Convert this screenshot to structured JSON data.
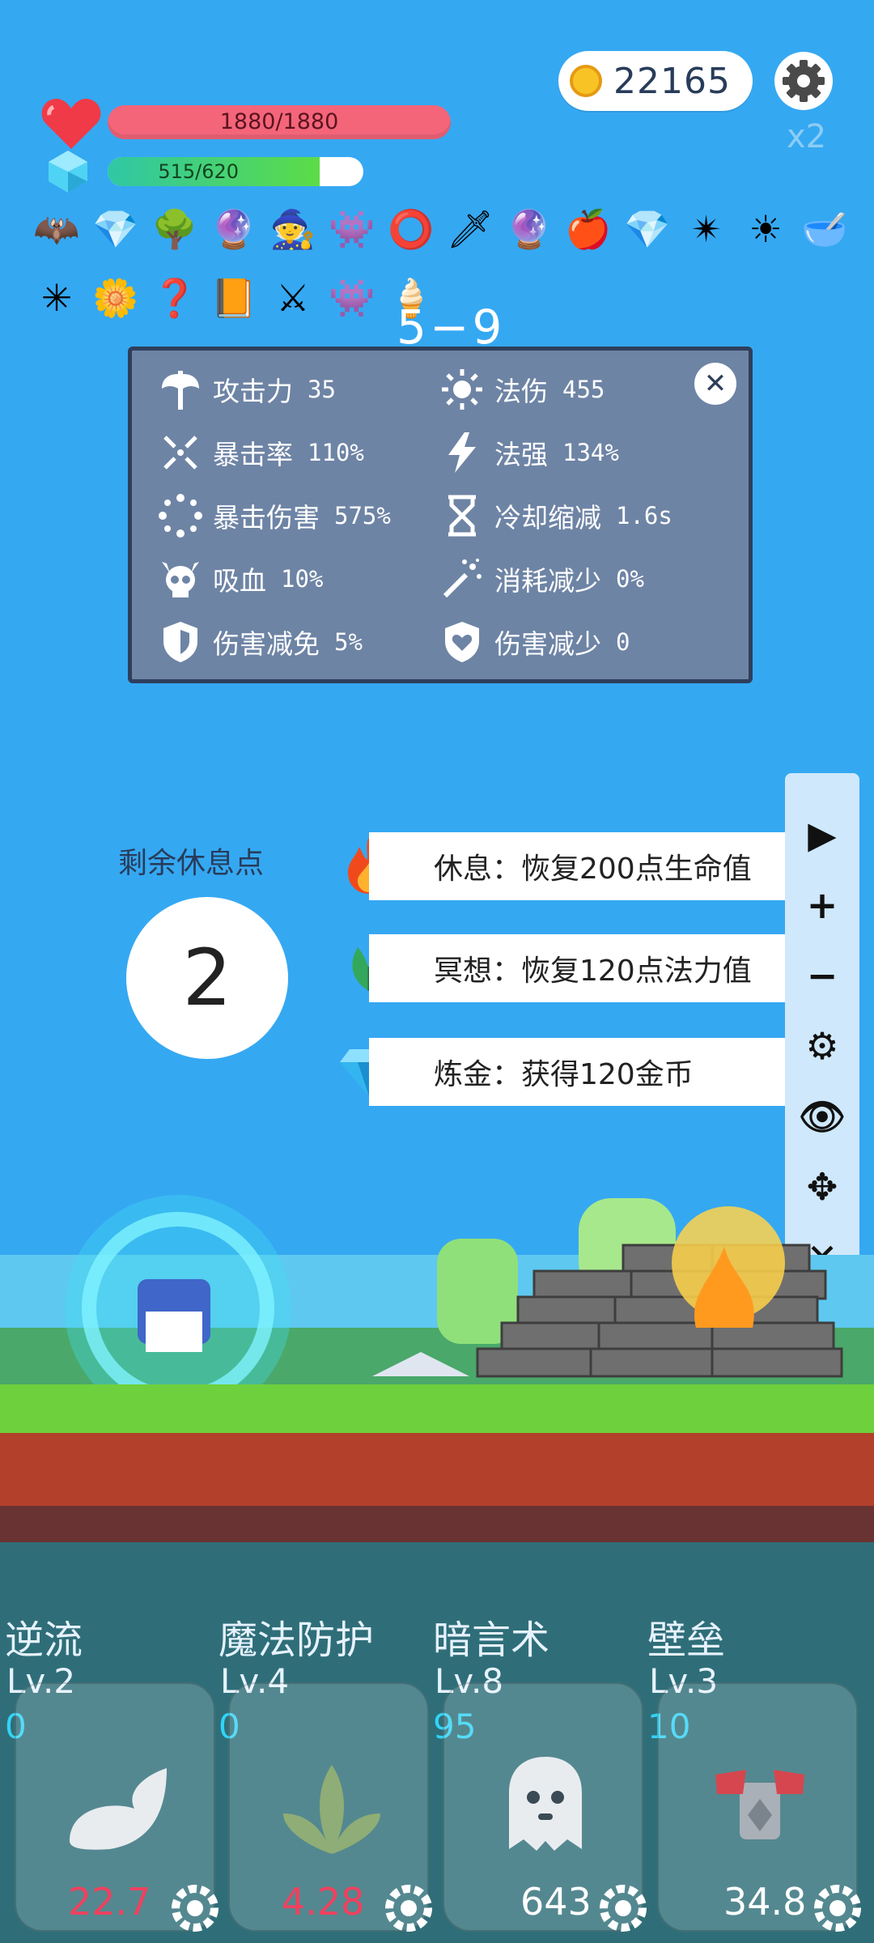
{
  "hud": {
    "coins": "22165",
    "speed": "x2",
    "hp_text": "1880/1880",
    "hp_fraction": 1.0,
    "mp_text": "515/620",
    "mp_fraction": 0.83
  },
  "stage": "5−9",
  "items_row1": [
    "bat",
    "diamond",
    "tree",
    "crystal-ball",
    "wizard-hat",
    "green-slime",
    "shield-ring",
    "dagger",
    "crystal-ball",
    "apple",
    "diamond",
    "spiked-ball",
    "sun",
    "mortar"
  ],
  "items_row2": [
    "spiked-mace",
    "flower",
    "hook",
    "book",
    "sword",
    "green-slime",
    "ice-cream"
  ],
  "stats": {
    "items": [
      {
        "label": "攻击力",
        "value": "35",
        "icon": "axe-icon"
      },
      {
        "label": "法伤",
        "value": "455",
        "icon": "sun-icon"
      },
      {
        "label": "暴击率",
        "value": "110%",
        "icon": "crit-icon"
      },
      {
        "label": "法强",
        "value": "134%",
        "icon": "lightning-icon"
      },
      {
        "label": "暴击伤害",
        "value": "575%",
        "icon": "circle-dots-icon"
      },
      {
        "label": "冷却缩减",
        "value": "1.6s",
        "icon": "hourglass-icon"
      },
      {
        "label": "吸血",
        "value": "10%",
        "icon": "skull-icon"
      },
      {
        "label": "消耗减少",
        "value": "0%",
        "icon": "wand-icon"
      },
      {
        "label": "伤害减免",
        "value": "5%",
        "icon": "shield-icon"
      },
      {
        "label": "伤害减少",
        "value": "0",
        "icon": "heart-shield-icon"
      }
    ]
  },
  "rest": {
    "label": "剩余休息点",
    "points": "2",
    "options": [
      {
        "text": "休息：恢复200点生命值",
        "icon": "fire-icon"
      },
      {
        "text": "冥想：恢复120点法力值",
        "icon": "leaf-icon"
      },
      {
        "text": "炼金：获得120金币",
        "icon": "diamond-icon"
      }
    ]
  },
  "toolbar": [
    "play",
    "plus",
    "minus",
    "gear",
    "eye",
    "move",
    "close"
  ],
  "skills": [
    {
      "name": "逆流",
      "level": "Lv.2",
      "count": "0",
      "value": "22.7",
      "value_color": "#f0405e",
      "icon": "wing-icon"
    },
    {
      "name": "魔法防护",
      "level": "Lv.4",
      "count": "0",
      "value": "4.28",
      "value_color": "#f0405e",
      "icon": "leaf-icon"
    },
    {
      "name": "暗言术",
      "level": "Lv.8",
      "count": "95",
      "value": "643",
      "value_color": "#ffffff",
      "icon": "ghost-icon"
    },
    {
      "name": "壁垒",
      "level": "Lv.3",
      "count": "10",
      "value": "34.8",
      "value_color": "#ffffff",
      "icon": "armor-icon"
    }
  ]
}
